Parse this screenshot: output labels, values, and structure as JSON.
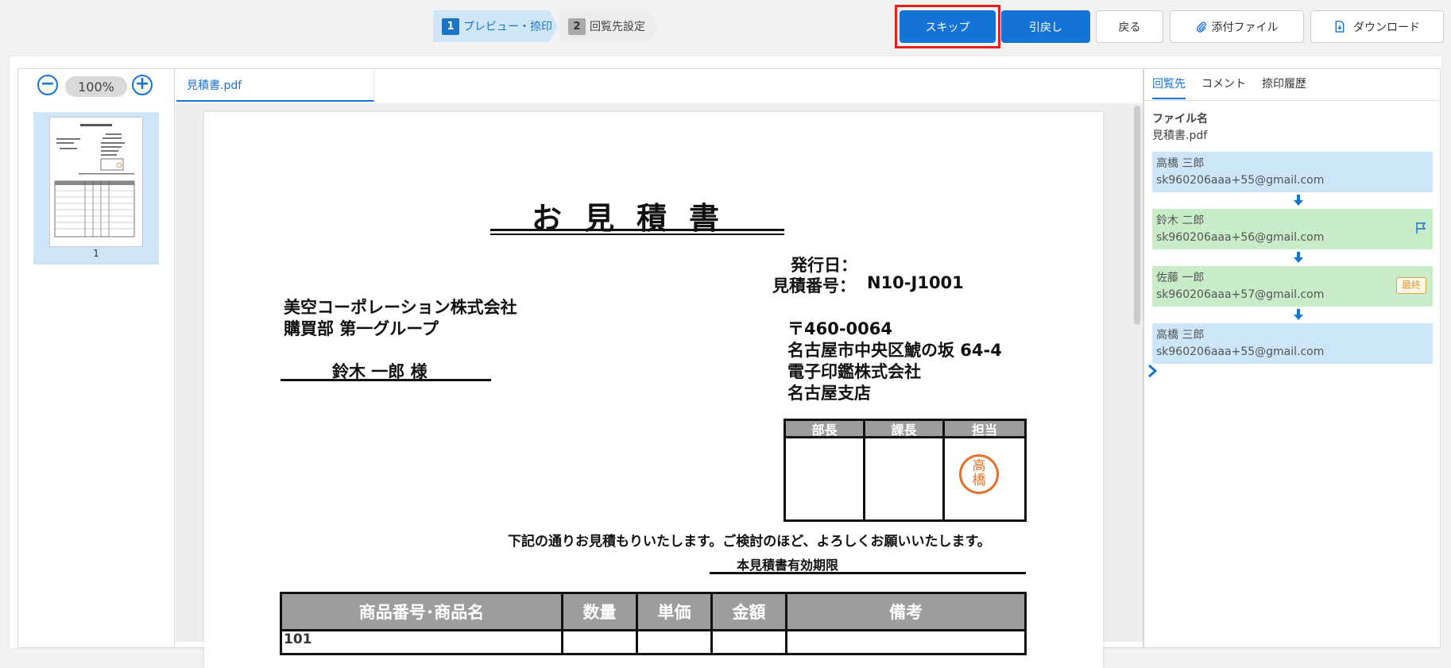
{
  "steps": [
    {
      "num": "1",
      "label": "プレビュー・捺印",
      "active": true
    },
    {
      "num": "2",
      "label": "回覧先設定",
      "active": false
    }
  ],
  "toolbar": {
    "skip": "スキップ",
    "pullback": "引戻し",
    "back": "戻る",
    "attach": "添付ファイル",
    "download": "ダウンロード"
  },
  "icons": {
    "zoom_out": "minus-circle-icon",
    "zoom_in": "plus-circle-icon",
    "attach": "paperclip-icon",
    "download": "download-file-icon",
    "flow_arrow": "arrow-down-icon",
    "flag": "flag-icon",
    "next": "chevron-right-icon"
  },
  "colors": {
    "accent": "#1473d6",
    "highlight": "#e5201b",
    "route_blue": "#cce5f7",
    "route_green": "#c8ecc8",
    "seal": "#e0722c"
  },
  "viewer": {
    "zoom_out": "−",
    "zoom_in": "+",
    "zoom_level": "100%",
    "thumbnail_page": "1",
    "file_tab": "見積書.pdf"
  },
  "document": {
    "title": "お見積書",
    "issue_date_label": "発行日：",
    "estimate_no_label": "見積番号：",
    "estimate_no": "N10-J1001",
    "company": "美空コーポレーション株式会社",
    "department": "購買部 第一グループ",
    "recipient": "鈴木 一郎 様",
    "postal": "〒460-0064",
    "address": "名古屋市中央区鯱の坂 64-4",
    "issuer": "電子印鑑株式会社",
    "branch": "名古屋支店",
    "stamp_headers": [
      "部長",
      "課長",
      "担当"
    ],
    "seal_chars": [
      "高",
      "橋"
    ],
    "message": "下記の通りお見積もりいたします。ご検討のほど、よろしくお願いいたします。",
    "validity_label": "本見積書有効期限",
    "table_headers": [
      "商品番号･商品名",
      "数量",
      "単価",
      "金額",
      "備考"
    ],
    "first_row_partial": "101"
  },
  "sidebar": {
    "tabs": [
      "回覧先",
      "コメント",
      "捺印履歴"
    ],
    "file_label": "ファイル名",
    "file_name": "見積書.pdf",
    "route": [
      {
        "name": "高橋 三郎",
        "email": "sk960206aaa+55@gmail.com",
        "color": "blue"
      },
      {
        "name": "鈴木 二郎",
        "email": "sk960206aaa+56@gmail.com",
        "color": "green",
        "flag": true
      },
      {
        "name": "佐藤 一郎",
        "email": "sk960206aaa+57@gmail.com",
        "color": "green",
        "badge": "最終"
      },
      {
        "name": "高橋 三郎",
        "email": "sk960206aaa+55@gmail.com",
        "color": "blue"
      }
    ]
  }
}
